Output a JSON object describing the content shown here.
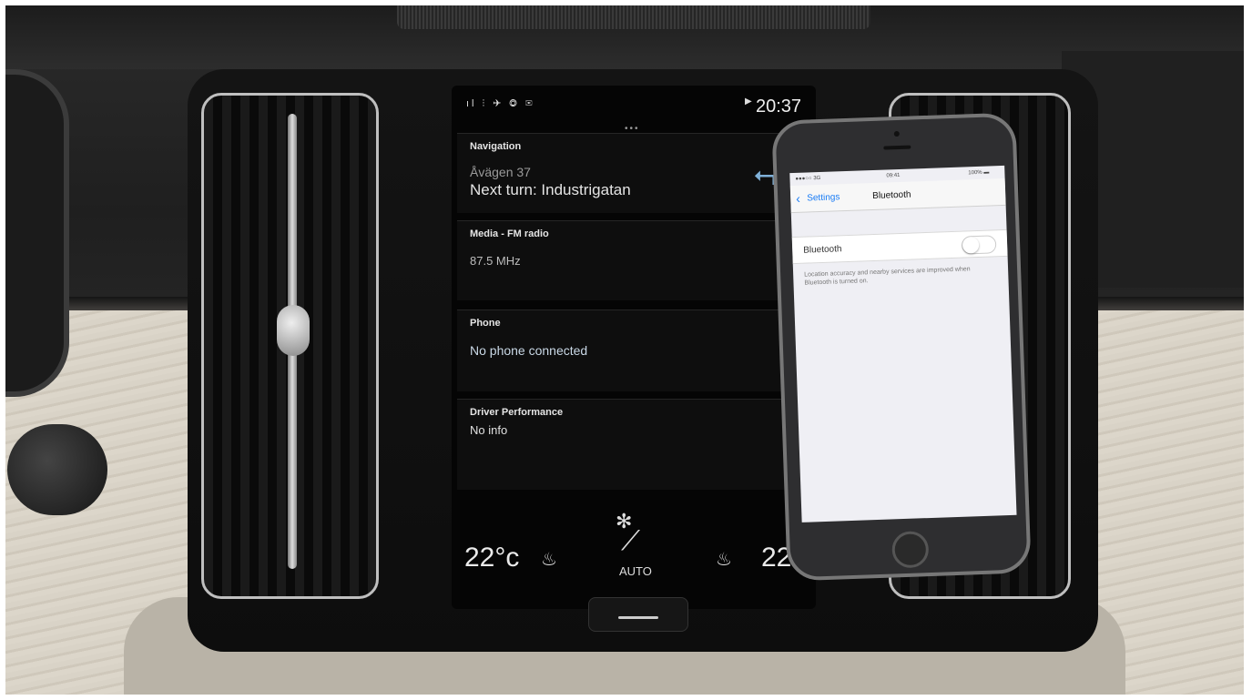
{
  "car_display": {
    "status_bar": {
      "icons_text": "ıl ⫶ ✈ ◎ ✉",
      "clock": "20:37"
    },
    "navigation": {
      "title": "Navigation",
      "address": "Åvägen 37",
      "next_turn": "Next turn: Industrigatan"
    },
    "media": {
      "title": "Media - FM radio",
      "frequency": "87.5 MHz"
    },
    "phone": {
      "title": "Phone",
      "status": "No phone connected"
    },
    "drive_performance": {
      "title": "Driver Performance",
      "info": "No info"
    },
    "climate": {
      "temp_left": "22°c",
      "temp_right": "22°c",
      "mode_label": "AUTO"
    }
  },
  "phone_screen": {
    "status": {
      "carrier": "●●●○○ 3G",
      "time": "09:41",
      "battery": "100% ▬"
    },
    "nav": {
      "back_label": "Settings",
      "title": "Bluetooth"
    },
    "bluetooth_label": "Bluetooth",
    "bluetooth_enabled": false,
    "note": "Location accuracy and nearby services are improved when Bluetooth is turned on."
  },
  "icons": [
    "signal-icon",
    "play-icon",
    "turn-left-icon",
    "seat-heat-icon",
    "fan-icon",
    "climate-icon",
    "back-chevron-icon"
  ]
}
